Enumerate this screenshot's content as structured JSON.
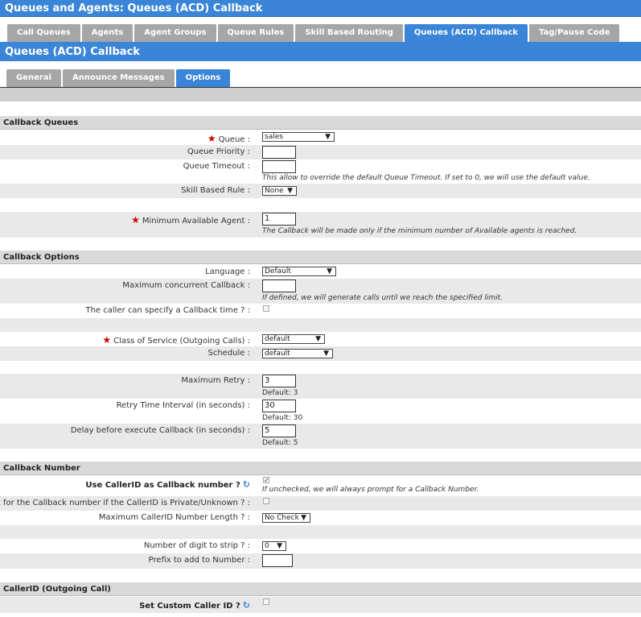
{
  "title": "Queues and Agents:  Queues (ACD) Callback",
  "main_tabs": [
    "Call Queues",
    "Agents",
    "Agent Groups",
    "Queue Rules",
    "Skill Based Routing",
    "Queues (ACD) Callback",
    "Tag/Pause Code"
  ],
  "main_tab_active": "Queues (ACD) Callback",
  "subtitle": "Queues (ACD) Callback",
  "sub_tabs": [
    "General",
    "Announce Messages",
    "Options"
  ],
  "sub_tab_active": "Options",
  "sections": {
    "callback_queues": "Callback Queues",
    "callback_options": "Callback Options",
    "callback_number": "Callback Number",
    "callerid": "CallerID (Outgoing Call)"
  },
  "fields": {
    "queue": {
      "label": "Queue  :",
      "value": "sales"
    },
    "queue_priority": {
      "label": "Queue Priority  :",
      "value": ""
    },
    "queue_timeout": {
      "label": "Queue Timeout  :",
      "value": "",
      "hint": "This allow to override the default Queue Timeout. If set to 0, we will use the default value."
    },
    "skill_rule": {
      "label": "Skill Based Rule  :",
      "value": "None"
    },
    "min_agent": {
      "label": "Minimum Available Agent  :",
      "value": "1",
      "hint": "The Callback will be made only if the minimum number of Available agents is reached."
    },
    "language": {
      "label": "Language  :",
      "value": "Default"
    },
    "max_concurrent": {
      "label": "Maximum concurrent Callback  :",
      "value": "",
      "hint": "If defined, we will generate calls until we reach the specified limit."
    },
    "caller_time": {
      "label": "The caller can specify a Callback time ?  :",
      "checked": false
    },
    "class_of_service": {
      "label": "Class of Service (Outgoing Calls)  :",
      "value": "default"
    },
    "schedule": {
      "label": "Schedule  :",
      "value": "default"
    },
    "max_retry": {
      "label": "Maximum Retry  :",
      "value": "3",
      "default": "Default: 3"
    },
    "retry_interval": {
      "label": "Retry Time Interval (in seconds)  :",
      "value": "30",
      "default": "Default: 30"
    },
    "delay": {
      "label": "Delay before execute Callback (in seconds)  :",
      "value": "5",
      "default": "Default: 5"
    },
    "use_callerid": {
      "label": "Use CallerID as Callback number ?",
      "checked": true,
      "hint": "If unchecked, we will always prompt for a Callback Number."
    },
    "ask_private": {
      "label": "Ask for the Callback number if the CallerID is Private/Unknown ?  :",
      "checked": false
    },
    "max_cid_len": {
      "label": "Maximum CallerID Number Length ?  :",
      "value": "No Check"
    },
    "digits_strip": {
      "label": "Number of digit to strip ?  :",
      "value": "0"
    },
    "prefix": {
      "label": "Prefix to add to Number  :",
      "value": ""
    },
    "custom_cid": {
      "label": "Set Custom Caller ID ?",
      "checked": false
    }
  },
  "icons": {
    "required": "required-star-icon",
    "refresh": "refresh-icon",
    "dropdown": "chevron-down-icon"
  },
  "colors": {
    "accent": "#3a85d8",
    "tab_inactive": "#a6a6a6",
    "required": "#cc0000"
  }
}
